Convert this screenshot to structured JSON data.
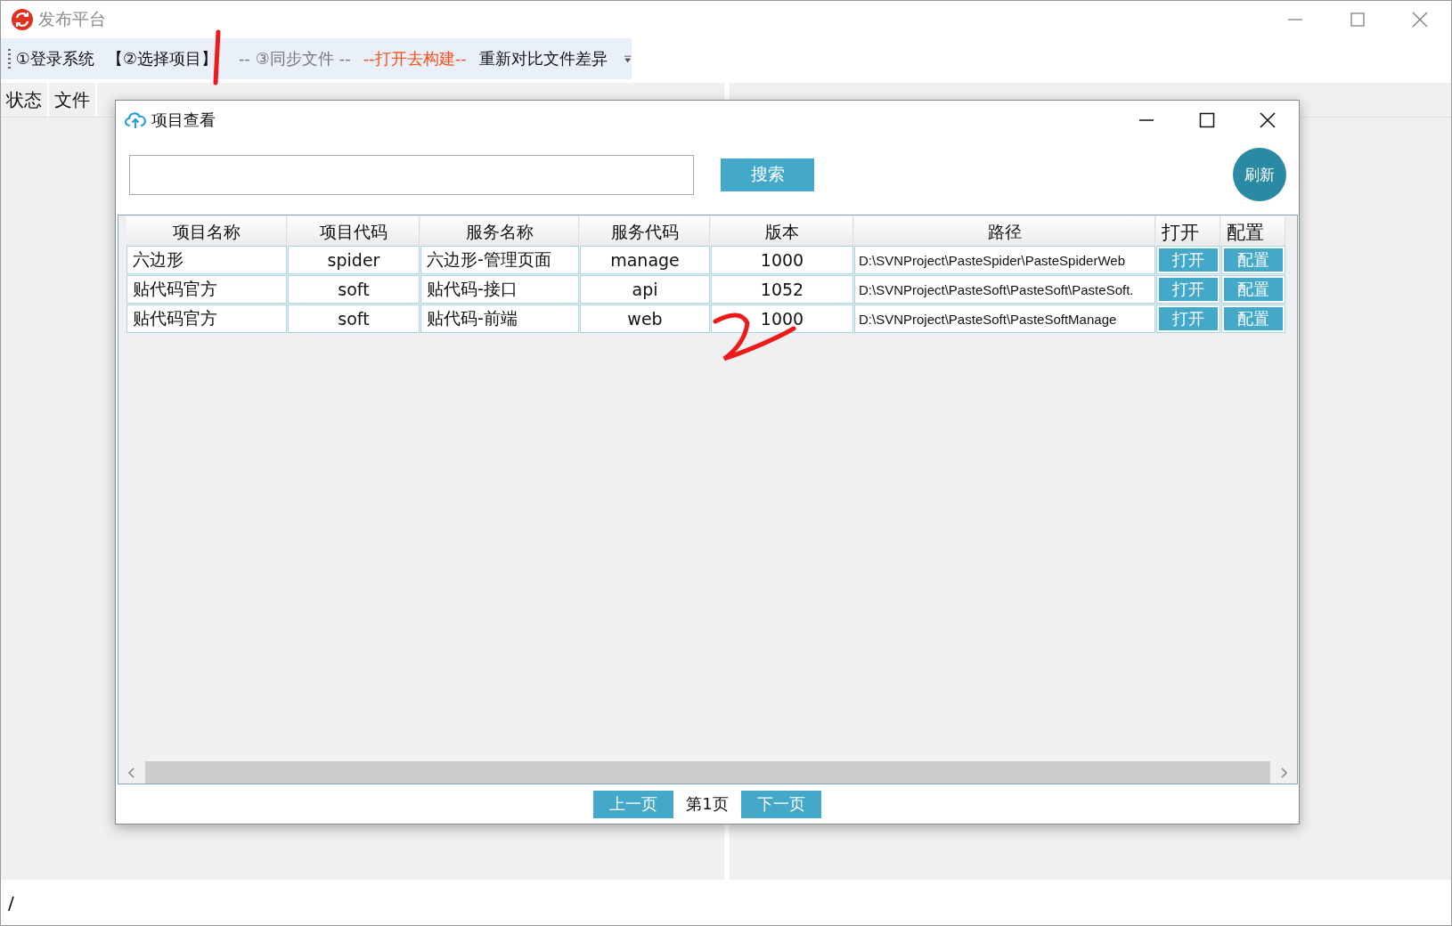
{
  "window": {
    "title": "发布平台"
  },
  "toolbar": {
    "items": [
      {
        "label": "①登录系统",
        "kind": "normal"
      },
      {
        "label": "【②选择项目】",
        "kind": "normal"
      },
      {
        "label": "-- ③同步文件 --",
        "kind": "muted"
      },
      {
        "label": "--打开去构建--",
        "kind": "accent"
      },
      {
        "label": "重新对比文件差异",
        "kind": "normal"
      }
    ]
  },
  "left_panel": {
    "columns": [
      "状态",
      "文件"
    ]
  },
  "dialog": {
    "title": "项目查看",
    "search_button": "搜索",
    "refresh_button": "刷新",
    "table": {
      "columns": [
        "项目名称",
        "项目代码",
        "服务名称",
        "服务代码",
        "版本",
        "路径",
        "打开",
        "配置"
      ],
      "rows": [
        {
          "cells": [
            "六边形",
            "spider",
            "六边形-管理页面",
            "manage",
            "1000",
            "D:\\SVNProject\\PasteSpider\\PasteSpiderWeb"
          ],
          "open": "打开",
          "config": "配置"
        },
        {
          "cells": [
            "贴代码官方",
            "soft",
            "贴代码-接口",
            "api",
            "1052",
            "D:\\SVNProject\\PasteSoft\\PasteSoft\\PasteSoft."
          ],
          "open": "打开",
          "config": "配置"
        },
        {
          "cells": [
            "贴代码官方",
            "soft",
            "贴代码-前端",
            "web",
            "1000",
            "D:\\SVNProject\\PasteSoft\\PasteSoftManage"
          ],
          "open": "打开",
          "config": "配置"
        }
      ]
    },
    "pagination": {
      "prev": "上一页",
      "page": "第1页",
      "next": "下一页"
    }
  },
  "status_bar": {
    "text": "/"
  }
}
